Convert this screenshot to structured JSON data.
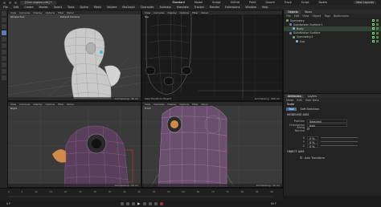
{
  "titlebar": {
    "doc_tab": "[Gum pigeon.c4d] *",
    "layouts": [
      "Standard",
      "Model",
      "Sculpt",
      "UVEdit",
      "Paint",
      "Groom",
      "Track",
      "Script",
      "Nodes"
    ],
    "new_layouts": "New Layouts"
  },
  "menu": {
    "items": [
      "File",
      "Edit",
      "Create",
      "Modes",
      "Select",
      "Tools",
      "Spline",
      "Mesh",
      "Volume",
      "MoGraph",
      "Character",
      "Animate",
      "Simulate",
      "Tracker",
      "Render",
      "Extensions",
      "Window",
      "Help"
    ]
  },
  "viewports": [
    {
      "menu": [
        "View",
        "Cameras",
        "Display",
        "Options",
        "Filter",
        "Panel"
      ],
      "label": "Perspective",
      "camera": "Default Camera",
      "foot_left": "",
      "foot_right": "Grid Spacing : 50 cm"
    },
    {
      "menu": [
        "View",
        "Cameras",
        "Display",
        "Options",
        "Filter",
        "Panel"
      ],
      "label": "Top",
      "camera": "",
      "foot_left": "View Transform: Project",
      "foot_right": "Grid Spacing : 500 cm"
    },
    {
      "menu": [
        "View",
        "Cameras",
        "Display",
        "Options",
        "Filter",
        "Panel"
      ],
      "label": "Right",
      "camera": "",
      "foot_left": "",
      "foot_right": "Grid Spacing : 50 cm"
    },
    {
      "menu": [
        "View",
        "Cameras",
        "Display",
        "Options",
        "Filter",
        "Panel"
      ],
      "label": "Front",
      "camera": "",
      "foot_left": "",
      "foot_right": "Grid Spacing : 50 cm"
    }
  ],
  "objects_panel": {
    "tabs": [
      "Objects",
      "Takes"
    ],
    "menu": [
      "File",
      "Edit",
      "View",
      "Object",
      "Tags",
      "Bookmarks"
    ],
    "items": [
      "Symmetry",
      "Subdivision Surface.1",
      "Body",
      "Subdivision Surface",
      "Symmetry.1",
      "Eye"
    ]
  },
  "attributes": {
    "tabs": [
      "Attributes",
      "Layers"
    ],
    "menu": [
      "Mode",
      "Edit",
      "User Data"
    ],
    "title": "Scale",
    "subtabs": [
      "Tool",
      "Soft Selection"
    ],
    "section": "MODELING AXIS",
    "rows": [
      {
        "k": "Position",
        "v": "Selected"
      },
      {
        "k": "Orientation",
        "v": "Axis"
      },
      {
        "k": "Along Normal",
        "v": ""
      }
    ],
    "values": [
      {
        "k": "X",
        "v": "0 %"
      },
      {
        "k": "Y",
        "v": "0 %"
      },
      {
        "k": "Z",
        "v": "0 %"
      }
    ],
    "section2": "OBJECT AXIS",
    "row2": "Axis Transform"
  },
  "timeline": {
    "ticks": [
      "0",
      "5",
      "10",
      "15",
      "20",
      "25",
      "30",
      "35",
      "40",
      "45",
      "50",
      "55",
      "60",
      "65",
      "70",
      "75",
      "80",
      "85",
      "90"
    ],
    "frame_left": "0 F",
    "frame_right": "90 F"
  }
}
